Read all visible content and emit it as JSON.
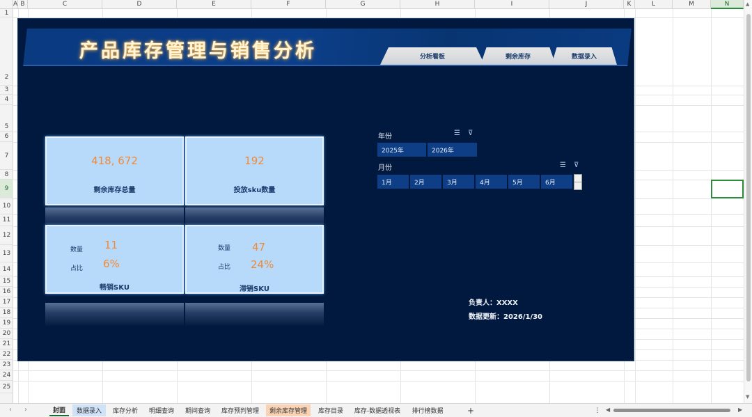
{
  "spreadsheet": {
    "columns": [
      "A",
      "B",
      "C",
      "D",
      "E",
      "F",
      "G",
      "H",
      "I",
      "J",
      "K",
      "L",
      "M",
      "N"
    ],
    "selected_column": "N",
    "rows": [
      "1",
      "2",
      "3",
      "4",
      "5",
      "6",
      "7",
      "8",
      "9",
      "10",
      "11",
      "12",
      "13",
      "14",
      "15",
      "16",
      "17",
      "18",
      "19",
      "20",
      "21",
      "22",
      "23",
      "24",
      "25"
    ],
    "selected_row": "9"
  },
  "dashboard": {
    "title": "产品库存管理与销售分析",
    "nav_tabs": [
      "分析看板",
      "剩余库存",
      "数据录入"
    ],
    "kpi_remaining": {
      "value": "418, 672",
      "label": "剩余库存总量"
    },
    "kpi_sku": {
      "value": "192",
      "label": "投放sku数量"
    },
    "best_selling": {
      "qty_label": "数量",
      "qty_value": "11",
      "ratio_label": "占比",
      "ratio_value": "6%",
      "label": "畅销SKU"
    },
    "slow_selling": {
      "qty_label": "数量",
      "qty_value": "47",
      "ratio_label": "占比",
      "ratio_value": "24%",
      "label": "滞销SKU"
    },
    "year_slicer": {
      "title": "年份",
      "items": [
        "2025年",
        "2026年"
      ]
    },
    "month_slicer": {
      "title": "月份",
      "items": [
        "1月",
        "2月",
        "3月",
        "4月",
        "5月",
        "6月"
      ]
    },
    "owner": "负责人：XXXX",
    "updated": "数据更新：2026/1/30"
  },
  "sheet_tabs": {
    "items": [
      "封面",
      "数据录入",
      "库存分析",
      "明细查询",
      "期间查询",
      "库存预判管理",
      "剩余库存管理",
      "库存目录",
      "库存-数据透视表",
      "排行榜数据"
    ],
    "active": "封面",
    "add": "+",
    "more": "⋮"
  },
  "colors": {
    "dashboard_bg": "#02193f",
    "kpi_card": "#b7dafa",
    "accent_orange": "#f08a36",
    "chip_blue": "#0e3e86",
    "tab_highlight_blue": "#cfe2f7",
    "tab_highlight_orange": "#f9d3b3"
  },
  "icons": {
    "multi_select": "multi-select-icon",
    "clear_filter": "clear-filter-icon"
  }
}
